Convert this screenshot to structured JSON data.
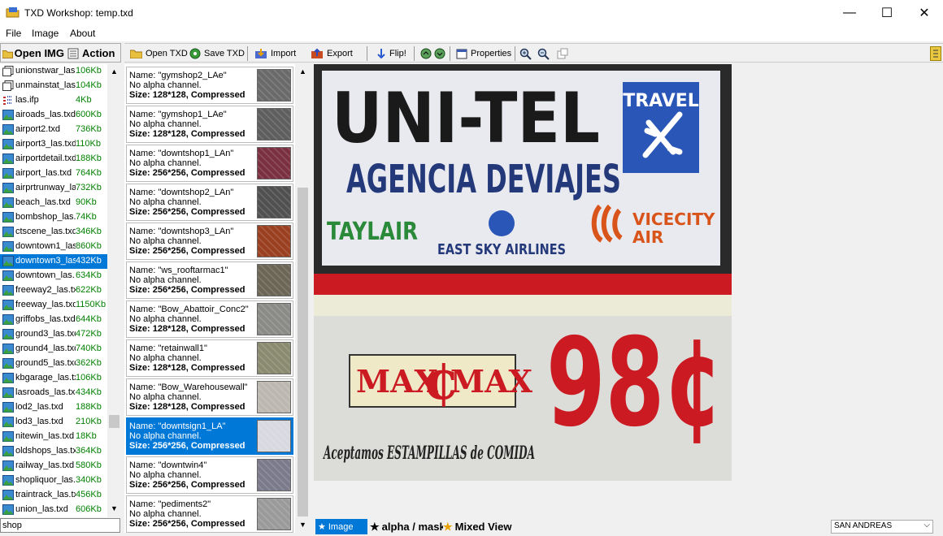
{
  "window": {
    "title": "TXD Workshop: temp.txd",
    "minimize": "—",
    "maximize": "☐",
    "close": "✕"
  },
  "menu": [
    "File",
    "Image",
    "About"
  ],
  "left_toolbar": {
    "open_img": "Open IMG",
    "action": "Action"
  },
  "toolbar": {
    "open_txd": "Open TXD",
    "save_txd": "Save TXD",
    "import": "Import",
    "export": "Export",
    "flip": "Flip!",
    "properties": "Properties"
  },
  "file_list": [
    {
      "name": "unionstwar_las",
      "size": "106Kb",
      "icon": "document-icon"
    },
    {
      "name": "unmainstat_las",
      "size": "104Kb",
      "icon": "document-icon"
    },
    {
      "name": "las.ifp",
      "size": "4Kb",
      "icon": "ifp-icon"
    },
    {
      "name": "airoads_las.txd",
      "size": "600Kb",
      "icon": "image-icon"
    },
    {
      "name": "airport2.txd",
      "size": "736Kb",
      "icon": "image-icon"
    },
    {
      "name": "airport3_las.txd",
      "size": "110Kb",
      "icon": "image-icon"
    },
    {
      "name": "airportdetail.txd",
      "size": "188Kb",
      "icon": "image-icon"
    },
    {
      "name": "airport_las.txd",
      "size": "764Kb",
      "icon": "image-icon"
    },
    {
      "name": "airprtrunway_las",
      "size": "732Kb",
      "icon": "image-icon"
    },
    {
      "name": "beach_las.txd",
      "size": "90Kb",
      "icon": "image-icon"
    },
    {
      "name": "bombshop_las.",
      "size": "74Kb",
      "icon": "image-icon"
    },
    {
      "name": "ctscene_las.txd",
      "size": "346Kb",
      "icon": "image-icon"
    },
    {
      "name": "downtown1_las",
      "size": "860Kb",
      "icon": "image-icon"
    },
    {
      "name": "downtown3_las",
      "size": "432Kb",
      "icon": "image-icon",
      "selected": true
    },
    {
      "name": "downtown_las.",
      "size": "634Kb",
      "icon": "image-icon"
    },
    {
      "name": "freeway2_las.txd",
      "size": "622Kb",
      "icon": "image-icon"
    },
    {
      "name": "freeway_las.txd",
      "size": "1150Kb",
      "icon": "image-icon"
    },
    {
      "name": "griffobs_las.txd",
      "size": "644Kb",
      "icon": "image-icon"
    },
    {
      "name": "ground3_las.txd",
      "size": "472Kb",
      "icon": "image-icon"
    },
    {
      "name": "ground4_las.txd",
      "size": "740Kb",
      "icon": "image-icon"
    },
    {
      "name": "ground5_las.txd",
      "size": "362Kb",
      "icon": "image-icon"
    },
    {
      "name": "kbgarage_las.txd",
      "size": "106Kb",
      "icon": "image-icon"
    },
    {
      "name": "lasroads_las.txd",
      "size": "434Kb",
      "icon": "image-icon"
    },
    {
      "name": "lod2_las.txd",
      "size": "188Kb",
      "icon": "image-icon"
    },
    {
      "name": "lod3_las.txd",
      "size": "210Kb",
      "icon": "image-icon"
    },
    {
      "name": "nitewin_las.txd",
      "size": "18Kb",
      "icon": "image-icon"
    },
    {
      "name": "oldshops_las.txd",
      "size": "364Kb",
      "icon": "image-icon"
    },
    {
      "name": "railway_las.txd",
      "size": "580Kb",
      "icon": "image-icon"
    },
    {
      "name": "shopliquor_las.",
      "size": "340Kb",
      "icon": "image-icon"
    },
    {
      "name": "traintrack_las.txd",
      "size": "456Kb",
      "icon": "image-icon"
    },
    {
      "name": "union_las.txd",
      "size": "606Kb",
      "icon": "image-icon"
    }
  ],
  "search": {
    "value": "shop"
  },
  "textures": [
    {
      "name": "Name: \"gymshop2_LAe\"",
      "alpha": "No alpha channel.",
      "size": "Size: 128*128, Compressed",
      "thumb": "#6a6a6a"
    },
    {
      "name": "Name: \"gymshop1_LAe\"",
      "alpha": "No alpha channel.",
      "size": "Size: 128*128, Compressed",
      "thumb": "#5e5e5e"
    },
    {
      "name": "Name: \"downtshop1_LAn\"",
      "alpha": "No alpha channel.",
      "size": "Size: 256*256, Compressed",
      "thumb": "#7a3040"
    },
    {
      "name": "Name: \"downtshop2_LAn\"",
      "alpha": "No alpha channel.",
      "size": "Size: 256*256, Compressed",
      "thumb": "#505050"
    },
    {
      "name": "Name: \"downtshop3_LAn\"",
      "alpha": "No alpha channel.",
      "size": "Size: 256*256, Compressed",
      "thumb": "#9a4020"
    },
    {
      "name": "Name: \"ws_rooftarmac1\"",
      "alpha": "No alpha channel.",
      "size": "Size: 256*256, Compressed",
      "thumb": "#6b6656"
    },
    {
      "name": "Name: \"Bow_Abattoir_Conc2\"",
      "alpha": "No alpha channel.",
      "size": "Size: 128*128, Compressed",
      "thumb": "#8a8a86"
    },
    {
      "name": "Name: \"retainwall1\"",
      "alpha": "No alpha channel.",
      "size": "Size: 128*128, Compressed",
      "thumb": "#8a8a70"
    },
    {
      "name": "Name: \"Bow_Warehousewall\"",
      "alpha": "No alpha channel.",
      "size": "Size: 128*128, Compressed",
      "thumb": "#bcb8b0"
    },
    {
      "name": "Name: \"downtsign1_LA\"",
      "alpha": "No alpha channel.",
      "size": "Size: 256*256, Compressed",
      "thumb": "#d8d8e0",
      "selected": true
    },
    {
      "name": "Name: \"downtwin4\"",
      "alpha": "No alpha channel.",
      "size": "Size: 256*256, Compressed",
      "thumb": "#7a7a8a"
    },
    {
      "name": "Name: \"pediments2\"",
      "alpha": "No alpha channel.",
      "size": "Size: 256*256, Compressed",
      "thumb": "#9a9a9a"
    }
  ],
  "preview": {
    "sign_top": "UNI-TEL",
    "sign_sub": "AGENCIA DEVIAJES",
    "travel": "TRAVEL",
    "taylair": "TAYLAIR",
    "east_sky": "EAST SKY AIRLINES",
    "vicecity": "VICECITY",
    "air": "AIR",
    "max": "MAX",
    "cent_small": "¢",
    "price": "98¢",
    "stamps": "Aceptamos ESTAMPILLAS de COMIDA"
  },
  "bottom_tabs": [
    "Image",
    "alpha / mask",
    "Mixed View"
  ],
  "game_select": "SAN ANDREAS",
  "colors": {
    "accent": "#0078d7",
    "size_green": "#008000",
    "sign_red": "#cc1a22",
    "sign_navy": "#24397a"
  }
}
